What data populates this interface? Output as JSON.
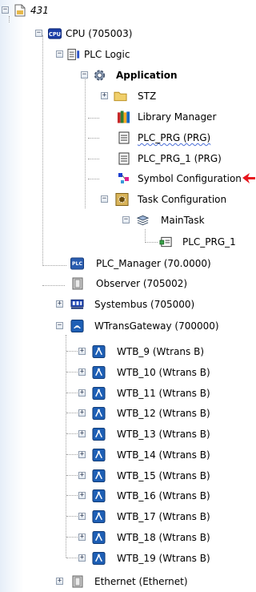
{
  "tree": {
    "root": {
      "label": "431"
    },
    "cpu": {
      "label": "CPU (705003)",
      "icon_text": "CPU"
    },
    "plc_logic": {
      "label": "PLC Logic"
    },
    "application": {
      "label": "Application"
    },
    "stz": {
      "label": "STZ"
    },
    "library_manager": {
      "label": "Library Manager"
    },
    "plc_prg": {
      "label": "PLC_PRG (PRG)"
    },
    "plc_prg_1": {
      "label": "PLC_PRG_1 (PRG)"
    },
    "symbol_configuration": {
      "label": "Symbol Configuration"
    },
    "task_configuration": {
      "label": "Task Configuration"
    },
    "main_task": {
      "label": "MainTask"
    },
    "main_task_call": {
      "label": "PLC_PRG_1"
    },
    "plc_manager": {
      "label": "PLC_Manager (70.0000)",
      "icon_text": "PLC"
    },
    "observer": {
      "label": "Observer (705002)"
    },
    "systembus": {
      "label": "Systembus (705000)"
    },
    "wtransgateway": {
      "label": "WTransGateway (700000)"
    },
    "wtb_items": [
      {
        "label": "WTB_9 (Wtrans B)"
      },
      {
        "label": "WTB_10 (Wtrans B)"
      },
      {
        "label": "WTB_11 (Wtrans B)"
      },
      {
        "label": "WTB_12 (Wtrans B)"
      },
      {
        "label": "WTB_13 (Wtrans B)"
      },
      {
        "label": "WTB_14 (Wtrans B)"
      },
      {
        "label": "WTB_15 (Wtrans B)"
      },
      {
        "label": "WTB_16 (Wtrans B)"
      },
      {
        "label": "WTB_17 (Wtrans B)"
      },
      {
        "label": "WTB_18 (Wtrans B)"
      },
      {
        "label": "WTB_19 (Wtrans B)"
      }
    ],
    "ethernet": {
      "label": "Ethernet (Ethernet)"
    }
  },
  "expander_symbols": {
    "expanded": "−",
    "collapsed": "+"
  },
  "colors": {
    "annotation_arrow": "#e8141c",
    "tree_line": "#a0a0a0",
    "spell_check": "#4a6fd8"
  }
}
